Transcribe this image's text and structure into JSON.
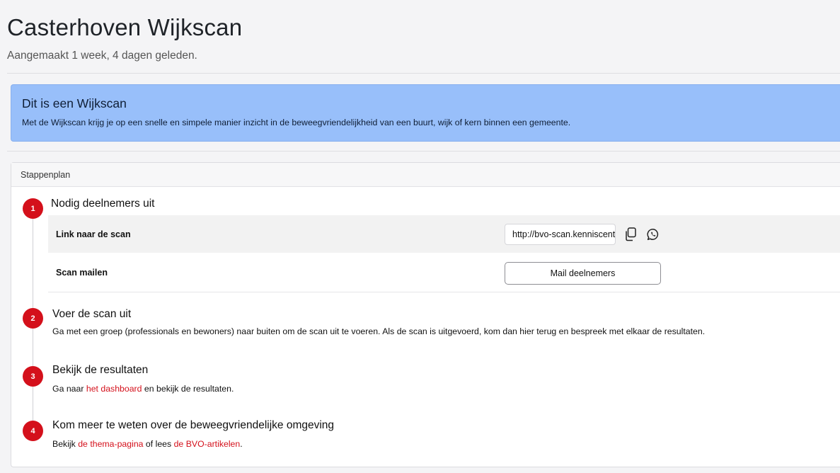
{
  "header": {
    "title": "Casterhoven Wijkscan",
    "subtitle": "Aangemaakt 1 week, 4 dagen geleden."
  },
  "info": {
    "title": "Dit is een Wijkscan",
    "text": "Met de Wijkscan krijg je op een snelle en simpele manier inzicht in de beweegvriendelijkheid van een buurt, wijk of kern binnen een gemeente.",
    "background_color": "#98bffa"
  },
  "card": {
    "header": "Stappenplan"
  },
  "steps": [
    {
      "number": "1",
      "title": "Nodig deelnemers uit",
      "link_label": "Link naar de scan",
      "link_value": "http://bvo-scan.kenniscentrumsportenbewegen.nl",
      "copy_icon": "copy-icon",
      "share_icon": "whatsapp-icon",
      "mail_label": "Scan mailen",
      "mail_button": "Mail deelnemers"
    },
    {
      "number": "2",
      "title": "Voer de scan uit",
      "text": "Ga met een groep (professionals en bewoners) naar buiten om de scan uit te voeren. Als de scan is uitgevoerd, kom dan hier terug en bespreek met elkaar de resultaten."
    },
    {
      "number": "3",
      "title": "Bekijk de resultaten",
      "text_before": "Ga naar ",
      "link": "het dashboard",
      "text_after": " en bekijk de resultaten."
    },
    {
      "number": "4",
      "title": "Kom meer te weten over de beweegvriendelijke omgeving",
      "text_before": "Bekijk ",
      "link1": "de thema-pagina",
      "text_middle": " of lees ",
      "link2": "de BVO-artikelen",
      "text_after": "."
    }
  ],
  "colors": {
    "accent": "#d4101b",
    "info_background": "#98bffa"
  }
}
